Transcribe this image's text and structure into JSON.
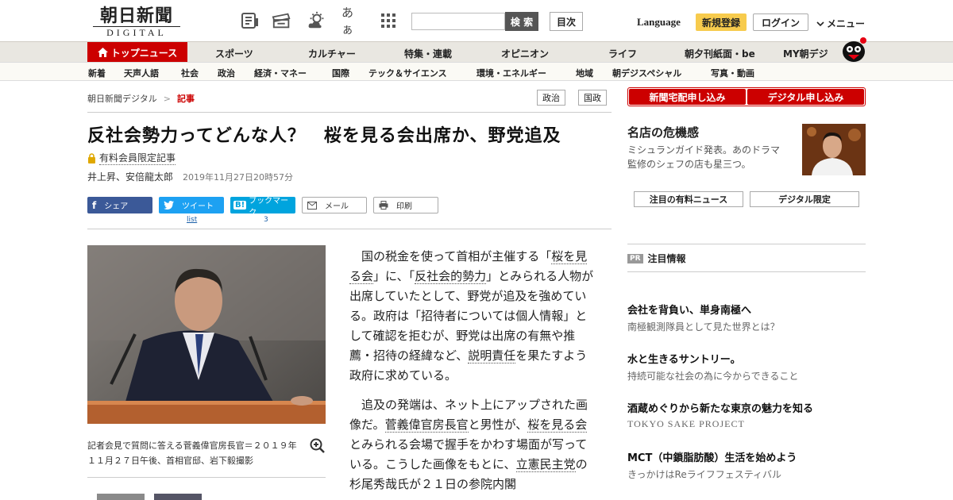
{
  "header": {
    "logo_main": "朝日新聞",
    "logo_sub": "DIGITAL",
    "icons": [
      "newspaper-icon",
      "ticket-icon",
      "weather-icon",
      "font-size-icon",
      "grid-icon"
    ],
    "font_icon_text": "あぁ",
    "search_placeholder": "",
    "search_label": "検 索",
    "index_label": "目次",
    "language_label": "Language",
    "signup_label": "新規登録",
    "login_label": "ログイン",
    "menu_label": "メニュー"
  },
  "nav_primary": {
    "home_label": "トップニュース",
    "items": [
      "スポーツ",
      "カルチャー",
      "特集・連載",
      "オピニオン",
      "ライフ",
      "朝夕刊紙面・be",
      "MY朝デジ"
    ]
  },
  "nav_secondary": {
    "items": [
      "新着",
      "天声人語",
      "社会",
      "政治",
      "経済・マネー",
      "国際",
      "テック＆サイエンス",
      "環境・エネルギー",
      "地域",
      "朝デジスペシャル",
      "写真・動画"
    ]
  },
  "breadcrumb": {
    "home": "朝日新聞デジタル",
    "sep": ">",
    "current": "記事",
    "tags": [
      "政治",
      "国政"
    ]
  },
  "article": {
    "headline": "反社会勢力ってどんな人？　桜を見る会出席か、野党追及",
    "paid_label": "有料会員限定記事",
    "authors": "井上昇、安倍龍太郎",
    "date": "2019年11月27日20時57分",
    "share": {
      "facebook": "シェア",
      "twitter": "ツイート",
      "hatena": "ブックマーク",
      "mail": "メール",
      "print": "印刷",
      "twitter_count": "list",
      "hatena_count": "3"
    },
    "caption": "記者会見で質問に答える菅義偉官房長官＝２０１９年１１月２７日午後、首相官邸、岩下毅撮影",
    "p1": {
      "a": "国の税金を使って首相が主催する「",
      "l1": "桜を見る会",
      "b": "」に、「",
      "l2": "反社会的勢力",
      "c": "」とみられる人物が出席していたとして、野党が追及を強めている。政府は「招待者については個人情報」として確認を拒むが、野党は出席の有無や推薦・招待の経緯など、",
      "l3": "説明責任",
      "d": "を果たすよう政府に求めている。"
    },
    "p2": {
      "a": "追及の発端は、ネット上にアップされた画像だ。",
      "l1": "菅義偉官房長官",
      "b": "と男性が、",
      "l2": "桜を見る会",
      "c": "とみられる会場で握手をかわす場面が写っている。こうした画像をもとに、",
      "l3": "立憲民主党",
      "d": "の杉尾秀哉氏が２１日の参院内閣"
    }
  },
  "sidebar": {
    "subscribe_newspaper": "新聞宅配申し込み",
    "subscribe_digital": "デジタル申し込み",
    "feature_title": "名店の危機感",
    "feature_desc": "ミシュランガイド発表。あのドラマ監修のシェフの店も星三つ。",
    "tab_paid_news": "注目の有料ニュース",
    "tab_digital_only": "デジタル限定",
    "pr_badge": "PR",
    "pr_title": "注目情報",
    "ads": [
      {
        "title": "会社を背負い、単身南極へ",
        "sub": "南極観測隊員として見た世界とは？"
      },
      {
        "title": "水と生きるサントリー。",
        "sub": "持続可能な社会の為に今からできること"
      },
      {
        "title": "酒蔵めぐりから新たな東京の魅力を知る",
        "sub": "TOKYO SAKE PROJECT"
      },
      {
        "title": "MCT（中鎖脂肪酸）生活を始めよう",
        "sub": "きっかけはReライフフェスティバル"
      }
    ]
  },
  "colors": {
    "brand_red": "#cc0000",
    "signup_yellow": "#f7cb4d",
    "facebook": "#3b5998",
    "twitter": "#1da1f2",
    "hatena": "#00a4de"
  }
}
